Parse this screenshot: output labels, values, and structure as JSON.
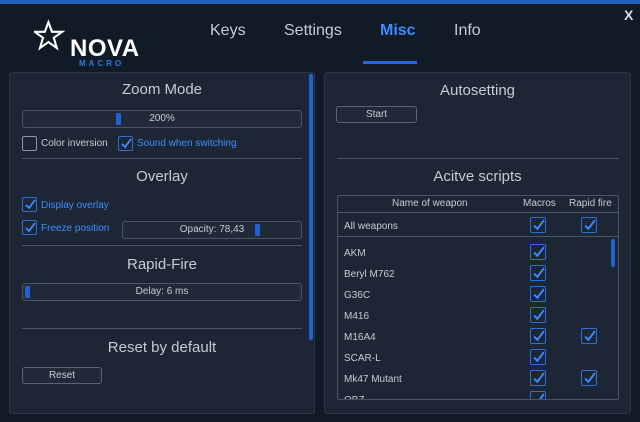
{
  "header": {
    "logo_text": "NOVA",
    "logo_sub": "MACRO",
    "tabs": [
      {
        "label": "Keys"
      },
      {
        "label": "Settings"
      },
      {
        "label": "Misc"
      },
      {
        "label": "Info"
      }
    ],
    "active_tab": "Misc",
    "close_label": "X"
  },
  "colors": {
    "accent": "#1f6ad8",
    "background": "#111a27",
    "panel": "#1d2634"
  },
  "zoom_mode": {
    "title": "Zoom Mode",
    "slider_label": "200%",
    "color_inversion_label": "Color inversion",
    "color_inversion_checked": false,
    "sound_label": "Sound when switching",
    "sound_checked": true
  },
  "overlay": {
    "title": "Overlay",
    "display_label": "Display overlay",
    "display_checked": true,
    "freeze_label": "Freeze position",
    "freeze_checked": true,
    "opacity_label": "Opacity: 78,43",
    "opacity_value": 78.43
  },
  "rapid_fire": {
    "title": "Rapid-Fire",
    "delay_label": "Delay: 6 ms"
  },
  "reset": {
    "title": "Reset by default",
    "button_label": "Reset"
  },
  "autosetting": {
    "title": "Autosetting",
    "start_label": "Start"
  },
  "scripts": {
    "title": "Acitve scripts",
    "columns": [
      "Name of weapon",
      "Macros",
      "Rapid fire"
    ],
    "all_label": "All weapons",
    "all_macros": true,
    "all_rapid": true,
    "rows": [
      {
        "name": "AKM",
        "macros": true,
        "rapid": false
      },
      {
        "name": "Beryl M762",
        "macros": true,
        "rapid": false
      },
      {
        "name": "G36C",
        "macros": true,
        "rapid": false
      },
      {
        "name": "M416",
        "macros": true,
        "rapid": false
      },
      {
        "name": "M16A4",
        "macros": true,
        "rapid": true
      },
      {
        "name": "SCAR-L",
        "macros": true,
        "rapid": false
      },
      {
        "name": "Mk47 Mutant",
        "macros": true,
        "rapid": true
      },
      {
        "name": "QBZ",
        "macros": true,
        "rapid": false
      }
    ]
  }
}
